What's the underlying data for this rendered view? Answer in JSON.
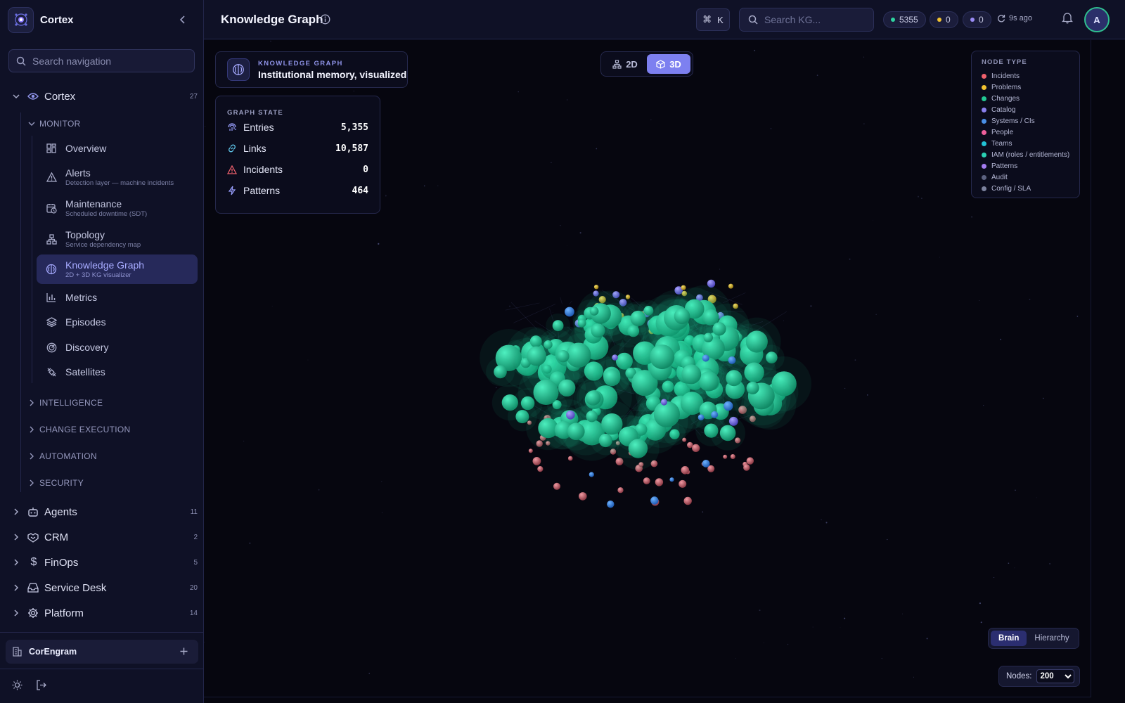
{
  "app": {
    "name": "Cortex",
    "colors": {
      "accent": "#7d80f0",
      "background": "#06060f",
      "sidebar": "#0f1126"
    }
  },
  "sidebar": {
    "search_placeholder": "Search navigation",
    "groups": [
      {
        "label": "Cortex",
        "count": "27",
        "expanded": true
      },
      {
        "label": "Agents",
        "count": "11"
      },
      {
        "label": "CRM",
        "count": "2"
      },
      {
        "label": "FinOps",
        "count": "5"
      },
      {
        "label": "Service Desk",
        "count": "20"
      },
      {
        "label": "Platform",
        "count": "14"
      }
    ],
    "sections": [
      "MONITOR",
      "INTELLIGENCE",
      "CHANGE EXECUTION",
      "AUTOMATION",
      "SECURITY"
    ],
    "monitor_items": [
      {
        "label": "Overview",
        "sub": "",
        "icon": "grid-icon"
      },
      {
        "label": "Alerts",
        "sub": "Detection layer — machine incidents",
        "icon": "warning-icon"
      },
      {
        "label": "Maintenance",
        "sub": "Scheduled downtime (SDT)",
        "icon": "calendar-clock-icon"
      },
      {
        "label": "Topology",
        "sub": "Service dependency map",
        "icon": "network-icon"
      },
      {
        "label": "Knowledge Graph",
        "sub": "2D + 3D KG visualizer",
        "icon": "brain-icon",
        "active": true
      },
      {
        "label": "Metrics",
        "sub": "",
        "icon": "bar-chart-icon"
      },
      {
        "label": "Episodes",
        "sub": "",
        "icon": "layers-icon"
      },
      {
        "label": "Discovery",
        "sub": "",
        "icon": "radar-icon"
      },
      {
        "label": "Satellites",
        "sub": "",
        "icon": "satellite-icon"
      }
    ],
    "workspace": {
      "name": "CorEngram"
    }
  },
  "header": {
    "title": "Knowledge Graph",
    "shortcut": {
      "symbol": "⌘",
      "key": "K"
    },
    "search_placeholder": "Search KG...",
    "stats": [
      {
        "value": "5355",
        "color": "#2fd3a0"
      },
      {
        "value": "0",
        "color": "#f2c230"
      },
      {
        "value": "0",
        "color": "#9a8cf5"
      }
    ],
    "refreshed": "9s ago",
    "avatar_initial": "A"
  },
  "kg_card": {
    "eyebrow": "KNOWLEDGE GRAPH",
    "headline": "Institutional memory, visualized"
  },
  "graph_state": {
    "heading": "GRAPH STATE",
    "rows": [
      {
        "label": "Entries",
        "value": "5,355",
        "icon": "fingerprint-icon",
        "color": "#9aa0ff"
      },
      {
        "label": "Links",
        "value": "10,587",
        "icon": "link-icon",
        "color": "#5fc4e8"
      },
      {
        "label": "Incidents",
        "value": "0",
        "icon": "alert-triangle-icon",
        "color": "#f0616d"
      },
      {
        "label": "Patterns",
        "value": "464",
        "icon": "bolt-icon",
        "color": "#9aa0ff"
      }
    ]
  },
  "view_mode": {
    "options": [
      "2D",
      "3D"
    ],
    "selected": "3D"
  },
  "legend": {
    "heading": "NODE TYPE",
    "items": [
      {
        "label": "Incidents",
        "color": "#f0616d"
      },
      {
        "label": "Problems",
        "color": "#f2c230"
      },
      {
        "label": "Changes",
        "color": "#22c993"
      },
      {
        "label": "Catalog",
        "color": "#8a80ee"
      },
      {
        "label": "Systems / CIs",
        "color": "#4a8fe6"
      },
      {
        "label": "People",
        "color": "#ee5f9c"
      },
      {
        "label": "Teams",
        "color": "#22c3d6"
      },
      {
        "label": "IAM (roles / entitlements)",
        "color": "#2ad0b3"
      },
      {
        "label": "Patterns",
        "color": "#a47cf2"
      },
      {
        "label": "Audit",
        "color": "#5c6280"
      },
      {
        "label": "Config / SLA",
        "color": "#7c829e"
      }
    ]
  },
  "layout_mode": {
    "options": [
      "Brain",
      "Hierarchy"
    ],
    "selected": "Brain"
  },
  "nodes_control": {
    "label": "Nodes:",
    "selected": "200",
    "options": [
      "200"
    ]
  }
}
